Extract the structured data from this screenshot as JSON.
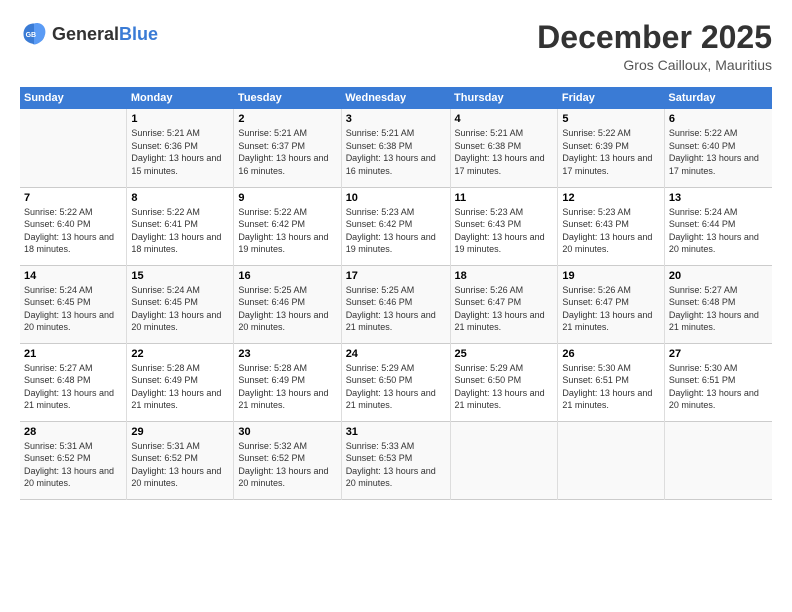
{
  "header": {
    "logo_general": "General",
    "logo_blue": "Blue",
    "month": "December 2025",
    "location": "Gros Cailloux, Mauritius"
  },
  "weekdays": [
    "Sunday",
    "Monday",
    "Tuesday",
    "Wednesday",
    "Thursday",
    "Friday",
    "Saturday"
  ],
  "weeks": [
    [
      {
        "day": "",
        "sunrise": "",
        "sunset": "",
        "daylight": ""
      },
      {
        "day": "1",
        "sunrise": "Sunrise: 5:21 AM",
        "sunset": "Sunset: 6:36 PM",
        "daylight": "Daylight: 13 hours and 15 minutes."
      },
      {
        "day": "2",
        "sunrise": "Sunrise: 5:21 AM",
        "sunset": "Sunset: 6:37 PM",
        "daylight": "Daylight: 13 hours and 16 minutes."
      },
      {
        "day": "3",
        "sunrise": "Sunrise: 5:21 AM",
        "sunset": "Sunset: 6:38 PM",
        "daylight": "Daylight: 13 hours and 16 minutes."
      },
      {
        "day": "4",
        "sunrise": "Sunrise: 5:21 AM",
        "sunset": "Sunset: 6:38 PM",
        "daylight": "Daylight: 13 hours and 17 minutes."
      },
      {
        "day": "5",
        "sunrise": "Sunrise: 5:22 AM",
        "sunset": "Sunset: 6:39 PM",
        "daylight": "Daylight: 13 hours and 17 minutes."
      },
      {
        "day": "6",
        "sunrise": "Sunrise: 5:22 AM",
        "sunset": "Sunset: 6:40 PM",
        "daylight": "Daylight: 13 hours and 17 minutes."
      }
    ],
    [
      {
        "day": "7",
        "sunrise": "Sunrise: 5:22 AM",
        "sunset": "Sunset: 6:40 PM",
        "daylight": "Daylight: 13 hours and 18 minutes."
      },
      {
        "day": "8",
        "sunrise": "Sunrise: 5:22 AM",
        "sunset": "Sunset: 6:41 PM",
        "daylight": "Daylight: 13 hours and 18 minutes."
      },
      {
        "day": "9",
        "sunrise": "Sunrise: 5:22 AM",
        "sunset": "Sunset: 6:42 PM",
        "daylight": "Daylight: 13 hours and 19 minutes."
      },
      {
        "day": "10",
        "sunrise": "Sunrise: 5:23 AM",
        "sunset": "Sunset: 6:42 PM",
        "daylight": "Daylight: 13 hours and 19 minutes."
      },
      {
        "day": "11",
        "sunrise": "Sunrise: 5:23 AM",
        "sunset": "Sunset: 6:43 PM",
        "daylight": "Daylight: 13 hours and 19 minutes."
      },
      {
        "day": "12",
        "sunrise": "Sunrise: 5:23 AM",
        "sunset": "Sunset: 6:43 PM",
        "daylight": "Daylight: 13 hours and 20 minutes."
      },
      {
        "day": "13",
        "sunrise": "Sunrise: 5:24 AM",
        "sunset": "Sunset: 6:44 PM",
        "daylight": "Daylight: 13 hours and 20 minutes."
      }
    ],
    [
      {
        "day": "14",
        "sunrise": "Sunrise: 5:24 AM",
        "sunset": "Sunset: 6:45 PM",
        "daylight": "Daylight: 13 hours and 20 minutes."
      },
      {
        "day": "15",
        "sunrise": "Sunrise: 5:24 AM",
        "sunset": "Sunset: 6:45 PM",
        "daylight": "Daylight: 13 hours and 20 minutes."
      },
      {
        "day": "16",
        "sunrise": "Sunrise: 5:25 AM",
        "sunset": "Sunset: 6:46 PM",
        "daylight": "Daylight: 13 hours and 20 minutes."
      },
      {
        "day": "17",
        "sunrise": "Sunrise: 5:25 AM",
        "sunset": "Sunset: 6:46 PM",
        "daylight": "Daylight: 13 hours and 21 minutes."
      },
      {
        "day": "18",
        "sunrise": "Sunrise: 5:26 AM",
        "sunset": "Sunset: 6:47 PM",
        "daylight": "Daylight: 13 hours and 21 minutes."
      },
      {
        "day": "19",
        "sunrise": "Sunrise: 5:26 AM",
        "sunset": "Sunset: 6:47 PM",
        "daylight": "Daylight: 13 hours and 21 minutes."
      },
      {
        "day": "20",
        "sunrise": "Sunrise: 5:27 AM",
        "sunset": "Sunset: 6:48 PM",
        "daylight": "Daylight: 13 hours and 21 minutes."
      }
    ],
    [
      {
        "day": "21",
        "sunrise": "Sunrise: 5:27 AM",
        "sunset": "Sunset: 6:48 PM",
        "daylight": "Daylight: 13 hours and 21 minutes."
      },
      {
        "day": "22",
        "sunrise": "Sunrise: 5:28 AM",
        "sunset": "Sunset: 6:49 PM",
        "daylight": "Daylight: 13 hours and 21 minutes."
      },
      {
        "day": "23",
        "sunrise": "Sunrise: 5:28 AM",
        "sunset": "Sunset: 6:49 PM",
        "daylight": "Daylight: 13 hours and 21 minutes."
      },
      {
        "day": "24",
        "sunrise": "Sunrise: 5:29 AM",
        "sunset": "Sunset: 6:50 PM",
        "daylight": "Daylight: 13 hours and 21 minutes."
      },
      {
        "day": "25",
        "sunrise": "Sunrise: 5:29 AM",
        "sunset": "Sunset: 6:50 PM",
        "daylight": "Daylight: 13 hours and 21 minutes."
      },
      {
        "day": "26",
        "sunrise": "Sunrise: 5:30 AM",
        "sunset": "Sunset: 6:51 PM",
        "daylight": "Daylight: 13 hours and 21 minutes."
      },
      {
        "day": "27",
        "sunrise": "Sunrise: 5:30 AM",
        "sunset": "Sunset: 6:51 PM",
        "daylight": "Daylight: 13 hours and 20 minutes."
      }
    ],
    [
      {
        "day": "28",
        "sunrise": "Sunrise: 5:31 AM",
        "sunset": "Sunset: 6:52 PM",
        "daylight": "Daylight: 13 hours and 20 minutes."
      },
      {
        "day": "29",
        "sunrise": "Sunrise: 5:31 AM",
        "sunset": "Sunset: 6:52 PM",
        "daylight": "Daylight: 13 hours and 20 minutes."
      },
      {
        "day": "30",
        "sunrise": "Sunrise: 5:32 AM",
        "sunset": "Sunset: 6:52 PM",
        "daylight": "Daylight: 13 hours and 20 minutes."
      },
      {
        "day": "31",
        "sunrise": "Sunrise: 5:33 AM",
        "sunset": "Sunset: 6:53 PM",
        "daylight": "Daylight: 13 hours and 20 minutes."
      },
      {
        "day": "",
        "sunrise": "",
        "sunset": "",
        "daylight": ""
      },
      {
        "day": "",
        "sunrise": "",
        "sunset": "",
        "daylight": ""
      },
      {
        "day": "",
        "sunrise": "",
        "sunset": "",
        "daylight": ""
      }
    ]
  ]
}
